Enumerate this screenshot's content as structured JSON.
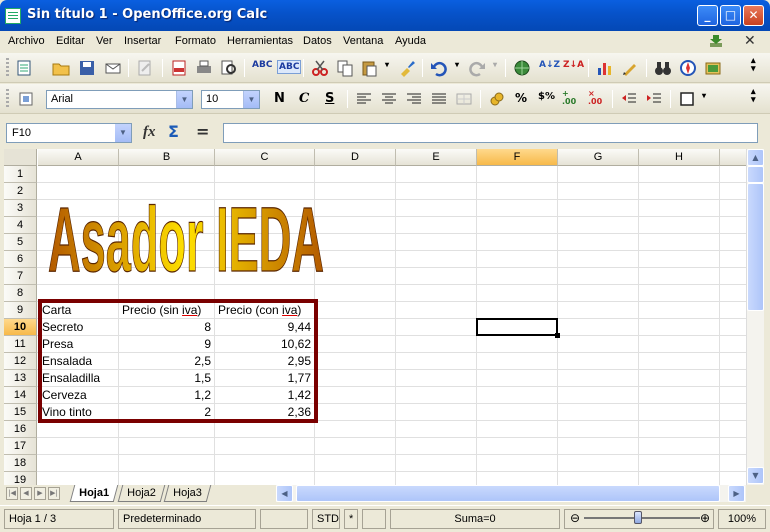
{
  "window": {
    "title": "Sin título 1 - OpenOffice.org Calc",
    "buttons": {
      "minimize": "_",
      "maximize": "□",
      "close": "✕"
    }
  },
  "menubar": {
    "items": [
      "Archivo",
      "Editar",
      "Ver",
      "Insertar",
      "Formato",
      "Herramientas",
      "Datos",
      "Ventana",
      "Ayuda"
    ],
    "close_doc": "✕"
  },
  "formatting": {
    "font_name": "Arial",
    "font_size": "10",
    "bold": "N",
    "italic": "C",
    "underline": "S"
  },
  "formula_bar": {
    "name_box": "F10",
    "content": ""
  },
  "grid": {
    "columns": [
      "A",
      "B",
      "C",
      "D",
      "E",
      "F",
      "G",
      "H"
    ],
    "selected_column": "F",
    "rows": [
      "1",
      "2",
      "3",
      "4",
      "5",
      "6",
      "7",
      "8",
      "9",
      "10",
      "11",
      "12",
      "13",
      "14",
      "15",
      "16",
      "17",
      "18",
      "19"
    ],
    "selected_row": "10",
    "wordart_text": "Asador IEDA",
    "table": {
      "headers": [
        "Carta",
        "Precio (sin iva)",
        "Precio (con iva)"
      ],
      "rows": [
        [
          "Secreto",
          "8",
          "9,44"
        ],
        [
          "Presa",
          "9",
          "10,62"
        ],
        [
          "Ensalada",
          "2,5",
          "2,95"
        ],
        [
          "Ensaladilla",
          "1,5",
          "1,77"
        ],
        [
          "Cerveza",
          "1,2",
          "1,42"
        ],
        [
          "Vino tinto",
          "2",
          "2,36"
        ]
      ]
    },
    "frame_color": "#7a0000"
  },
  "sheet_tabs": [
    "Hoja1",
    "Hoja2",
    "Hoja3"
  ],
  "active_sheet": "Hoja1",
  "statusbar": {
    "sheet": "Hoja 1 / 3",
    "style": "Predeterminado",
    "mode": "STD",
    "modified": "*",
    "sum": "Suma=0",
    "zoom": "100%"
  }
}
